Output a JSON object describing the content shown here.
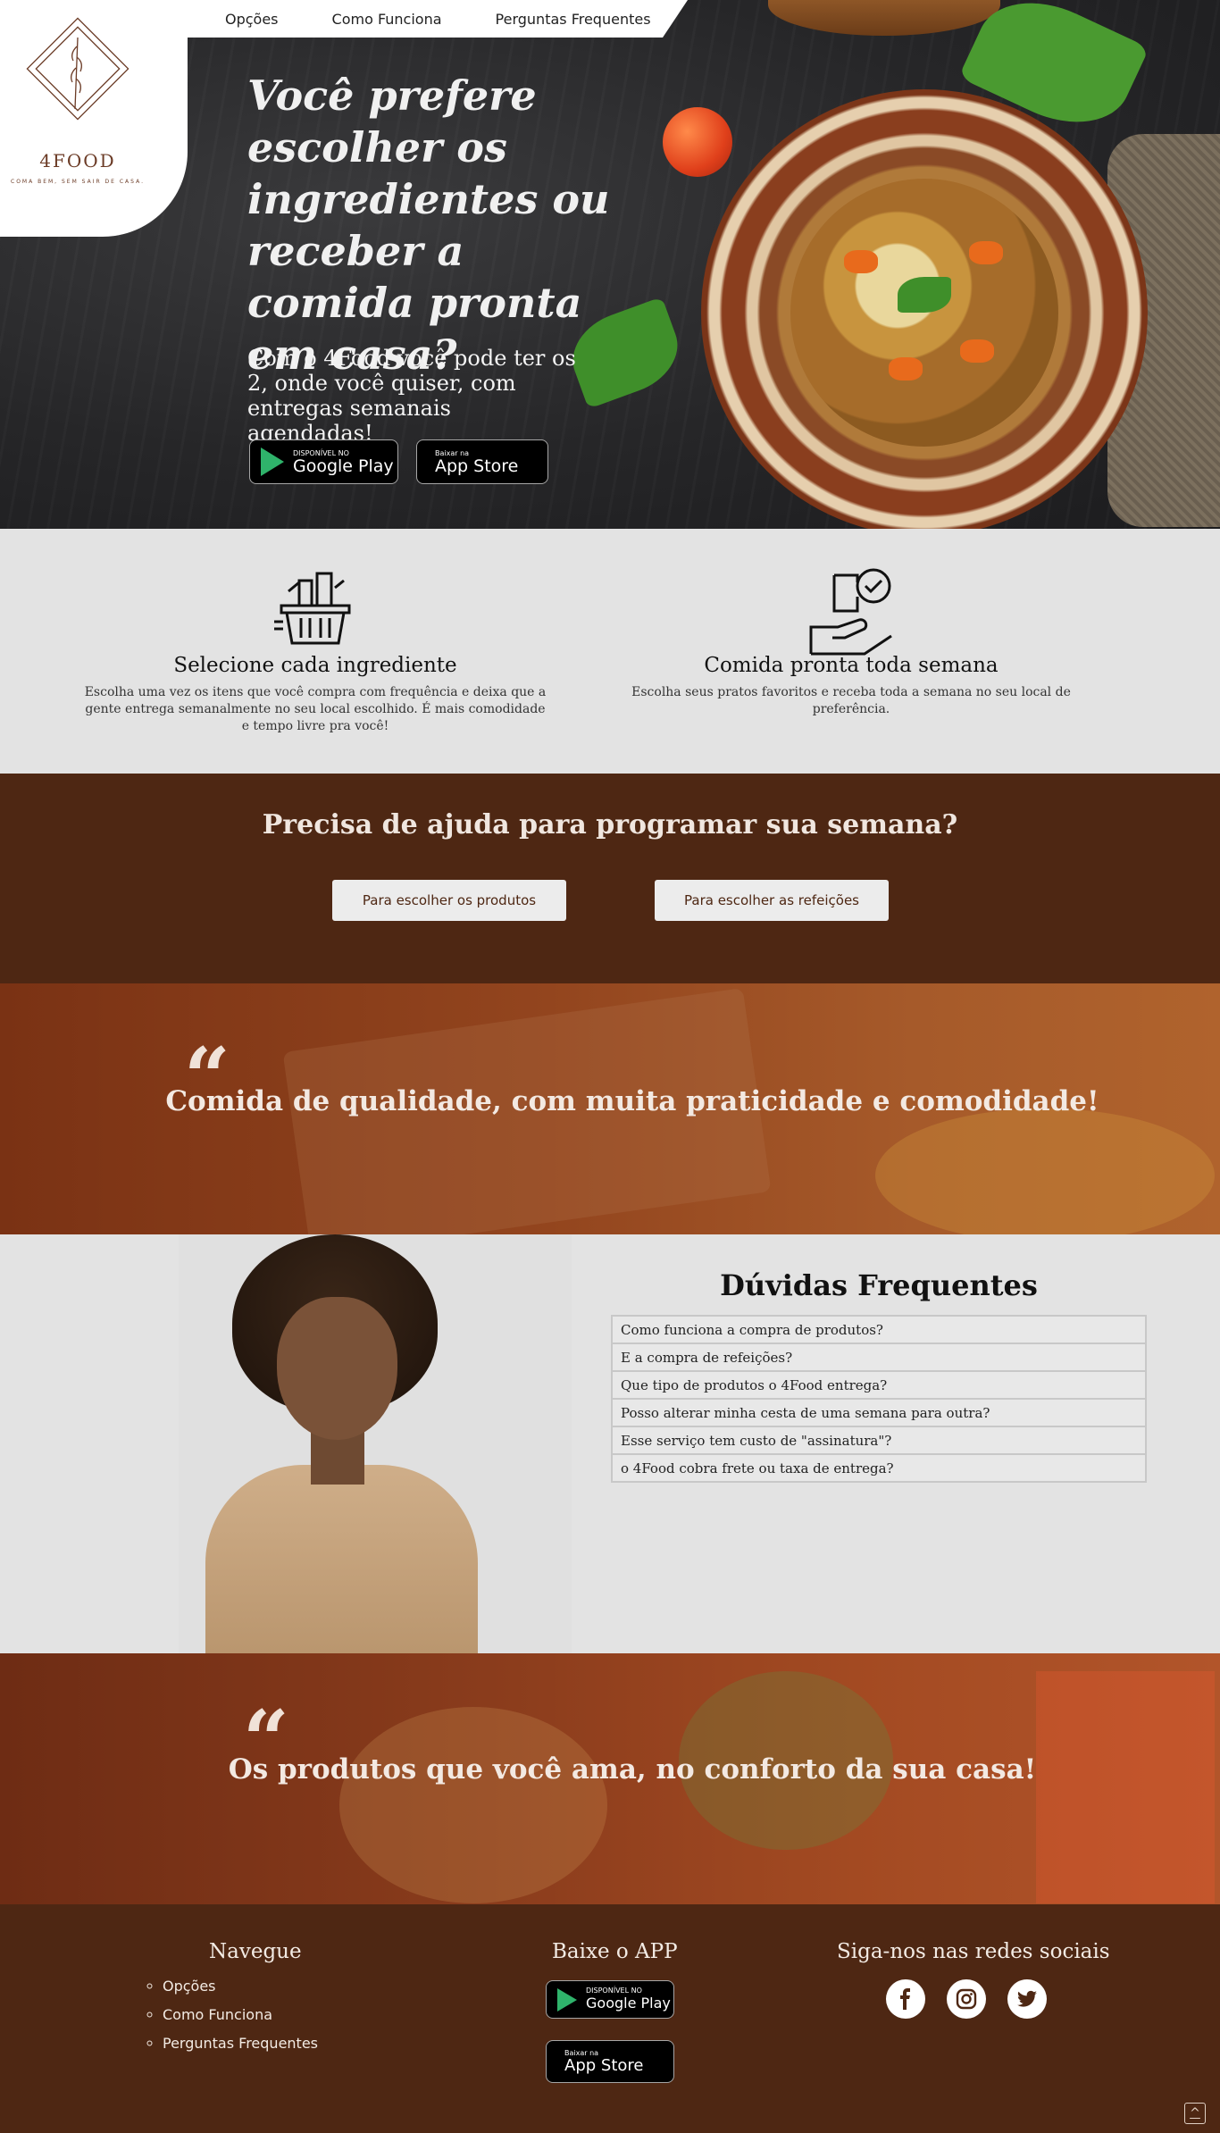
{
  "nav": {
    "items": [
      "Opções",
      "Como Funciona",
      "Perguntas Frequentes"
    ]
  },
  "logo": {
    "name": "4FOOD",
    "tagline": "COMA BEM, SEM SAIR DE CASA."
  },
  "hero": {
    "title": "Você prefere escolher os ingredientes ou receber a comida pronta em casa?",
    "subtitle": "Com o 4Food você pode ter os 2, onde você quiser, com entregas semanais agendadas!"
  },
  "stores": {
    "google_small": "DISPONÍVEL NO",
    "google_big": "Google Play",
    "apple_small": "Baixar na",
    "apple_big": "App Store"
  },
  "features": [
    {
      "icon": "shopping-basket-icon",
      "title": "Selecione cada ingrediente",
      "text": "Escolha uma vez os itens que você compra com frequência e deixa que a gente entrega semanalmente no seu local escolhido. É mais comodidade e tempo livre pra você!"
    },
    {
      "icon": "delivery-hand-check-icon",
      "title": "Comida pronta toda semana",
      "text": "Escolha seus pratos favoritos e receba toda a semana no seu local de preferência."
    }
  ],
  "help": {
    "title": "Precisa de ajuda para programar sua semana?",
    "btn_products": "Para escolher os produtos",
    "btn_meals": "Para escolher as refeições"
  },
  "quotes": {
    "mark": "“",
    "first": "Comida de qualidade, com muita praticidade e comodidade!",
    "second": "Os produtos que você ama, no conforto da sua casa!"
  },
  "faq": {
    "title": "Dúvidas Frequentes",
    "items": [
      "Como funciona a compra de produtos?",
      "E a compra de refeições?",
      "Que tipo de produtos o 4Food entrega?",
      "Posso alterar minha cesta de uma semana para outra?",
      "Esse serviço tem custo de \"assinatura\"?",
      "o 4Food cobra frete ou taxa de entrega?"
    ]
  },
  "footer": {
    "nav_title": "Navegue",
    "nav_items": [
      "Opções",
      "Como Funciona",
      "Perguntas Frequentes"
    ],
    "app_title": "Baixe o APP",
    "social_title": "Siga-nos nas redes sociais",
    "social": [
      "facebook-icon",
      "instagram-icon",
      "twitter-icon"
    ],
    "to_top": "^"
  },
  "colors": {
    "brand_brown": "#4e2713",
    "quote_rust": "#8a3a1a",
    "light_bg": "#e3e3e3"
  }
}
